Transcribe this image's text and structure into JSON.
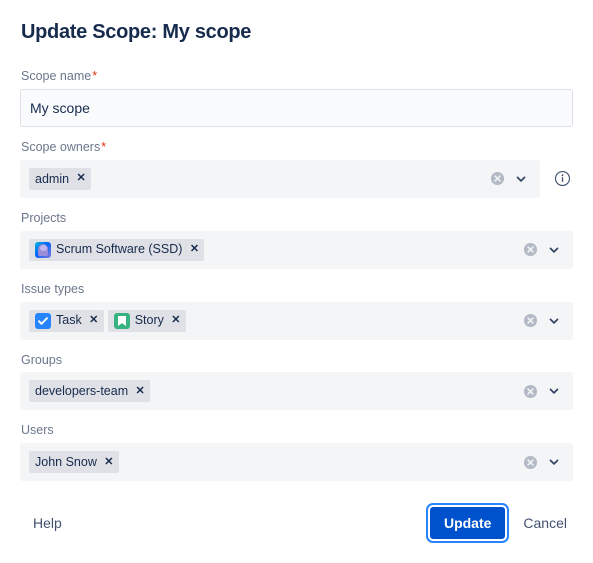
{
  "title": "Update Scope: My scope",
  "required_marker": "*",
  "fields": {
    "scope_name": {
      "label": "Scope name",
      "required": true,
      "value": "My scope",
      "placeholder": ""
    },
    "scope_owners": {
      "label": "Scope owners",
      "required": true,
      "chips": [
        {
          "label": "admin",
          "icon": "none"
        }
      ],
      "info_icon": "info-circle-icon"
    },
    "projects": {
      "label": "Projects",
      "required": false,
      "chips": [
        {
          "label": "Scrum Software (SSD)",
          "icon": "project-avatar-icon"
        }
      ]
    },
    "issue_types": {
      "label": "Issue types",
      "required": false,
      "chips": [
        {
          "label": "Task",
          "icon": "task-icon"
        },
        {
          "label": "Story",
          "icon": "story-icon"
        }
      ]
    },
    "groups": {
      "label": "Groups",
      "required": false,
      "chips": [
        {
          "label": "developers-team",
          "icon": "none"
        }
      ]
    },
    "users": {
      "label": "Users",
      "required": false,
      "chips": [
        {
          "label": "John Snow",
          "icon": "none"
        }
      ]
    }
  },
  "icons": {
    "clear": "clear-circle-icon",
    "chevron": "chevron-down-icon",
    "remove": "✕"
  },
  "footer": {
    "help_label": "Help",
    "update_label": "Update",
    "cancel_label": "Cancel"
  },
  "colors": {
    "primary_button": "#0052CC",
    "focus_ring": "#2684FF",
    "label_text": "#6B778C",
    "required_star": "#DE350B",
    "field_background": "#F4F5F7",
    "chip_background": "#DFE1E6",
    "task_icon": "#2684FF",
    "story_icon": "#36B37E",
    "title_text": "#172B4D"
  }
}
